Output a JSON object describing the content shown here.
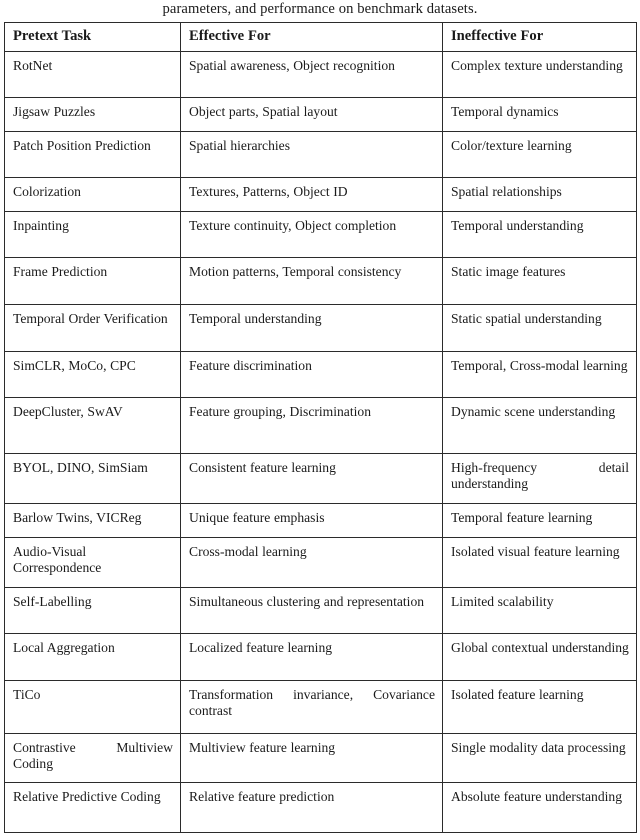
{
  "caption": {
    "continuation_line": "parameters, and performance on benchmark datasets."
  },
  "table": {
    "columns": [
      {
        "key": "task",
        "label": "Pretext Task"
      },
      {
        "key": "eff",
        "label": "Effective For"
      },
      {
        "key": "ineff",
        "label": "Ineffective For"
      }
    ],
    "rows": [
      {
        "task": "RotNet",
        "eff": "Spatial awareness, Object recognition",
        "ineff": "Complex texture understanding",
        "height": 46
      },
      {
        "task": "Jigsaw Puzzles",
        "eff": "Object parts, Spatial layout",
        "ineff": "Temporal dynamics",
        "height": 34
      },
      {
        "task": "Patch Position Prediction",
        "eff": "Spatial hierarchies",
        "ineff": "Color/texture learning",
        "height": 46
      },
      {
        "task": "Colorization",
        "eff": "Textures, Patterns, Object ID",
        "ineff": "Spatial relationships",
        "height": 34
      },
      {
        "task": "Inpainting",
        "eff": "Texture continuity, Object completion",
        "ineff": "Temporal understanding",
        "height": 46
      },
      {
        "task": "Frame Prediction",
        "eff": "Motion patterns, Temporal consistency",
        "ineff": "Static image features",
        "height": 47
      },
      {
        "task": "Temporal Order Verification",
        "eff": "Temporal understanding",
        "ineff": "Static spatial understanding",
        "height": 47
      },
      {
        "task": "SimCLR, MoCo, CPC",
        "eff": "Feature discrimination",
        "ineff": "Temporal, Cross-modal learning",
        "height": 46
      },
      {
        "task": "DeepCluster, SwAV",
        "eff": "Feature grouping, Discrimination",
        "ineff": "Dynamic scene understanding",
        "height": 56
      },
      {
        "task": "BYOL, DINO, SimSiam",
        "eff": "Consistent feature learning",
        "ineff": "High-frequency detail understanding",
        "height": 50
      },
      {
        "task": "Barlow Twins, VICReg",
        "eff": "Unique feature emphasis",
        "ineff": "Temporal feature learning",
        "height": 34
      },
      {
        "task": "Audio-Visual Correspondence",
        "eff": "Cross-modal learning",
        "ineff": "Isolated visual feature learning",
        "height": 50
      },
      {
        "task": "Self-Labelling",
        "eff": "Simultaneous clustering and representation",
        "ineff": "Limited scalability",
        "height": 46
      },
      {
        "task": "Local Aggregation",
        "eff": "Localized feature learning",
        "ineff": "Global contextual understanding",
        "height": 47
      },
      {
        "task": "TiCo",
        "eff": "Transformation invariance, Covariance contrast",
        "ineff": "Isolated feature learning",
        "height": 53
      },
      {
        "task": "Contrastive Multiview Coding",
        "eff": "Multiview feature learning",
        "ineff": "Single modality data processing",
        "height": 49
      },
      {
        "task": "Relative Predictive Coding",
        "eff": "Relative feature prediction",
        "ineff": "Absolute feature understanding",
        "height": 50
      }
    ]
  }
}
